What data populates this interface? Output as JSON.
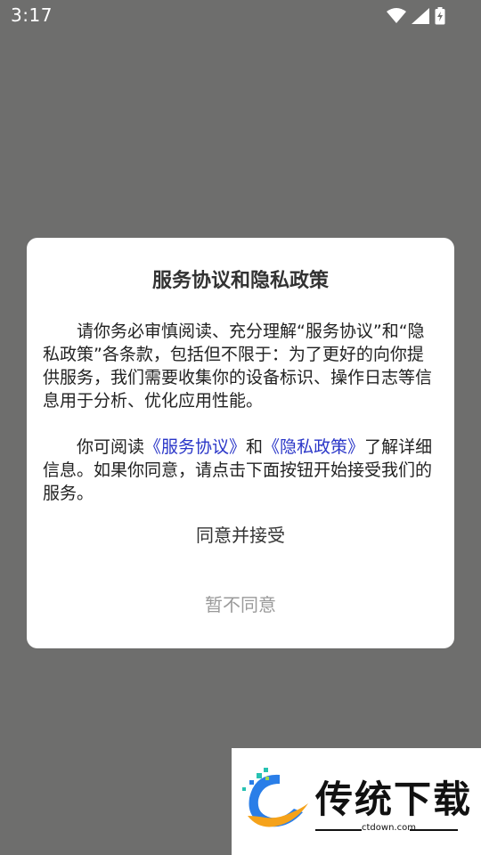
{
  "status_bar": {
    "time": "3:17"
  },
  "dialog": {
    "title": "服务协议和隐私政策",
    "para1": "请你务必审慎阅读、充分理解“服务协议”和“隐私政策”各条款，包括但不限于：为了更好的向你提供服务，我们需要收集你的设备标识、操作日志等信息用于分析、优化应用性能。",
    "para2_prefix": "你可阅读",
    "service_link": "《服务协议》",
    "para2_and": "和",
    "privacy_link": "《隐私政策》",
    "para2_suffix": "了解详细信息。如果你同意，请点击下面按钮开始接受我们的服务。",
    "accept_label": "同意并接受",
    "decline_label": "暂不同意"
  },
  "watermark": {
    "brand": "传统下载",
    "url": "ctdown.com"
  },
  "colors": {
    "overlay": "#6e6e6d",
    "link": "#2a36c8",
    "decline": "#9a9a9a"
  }
}
